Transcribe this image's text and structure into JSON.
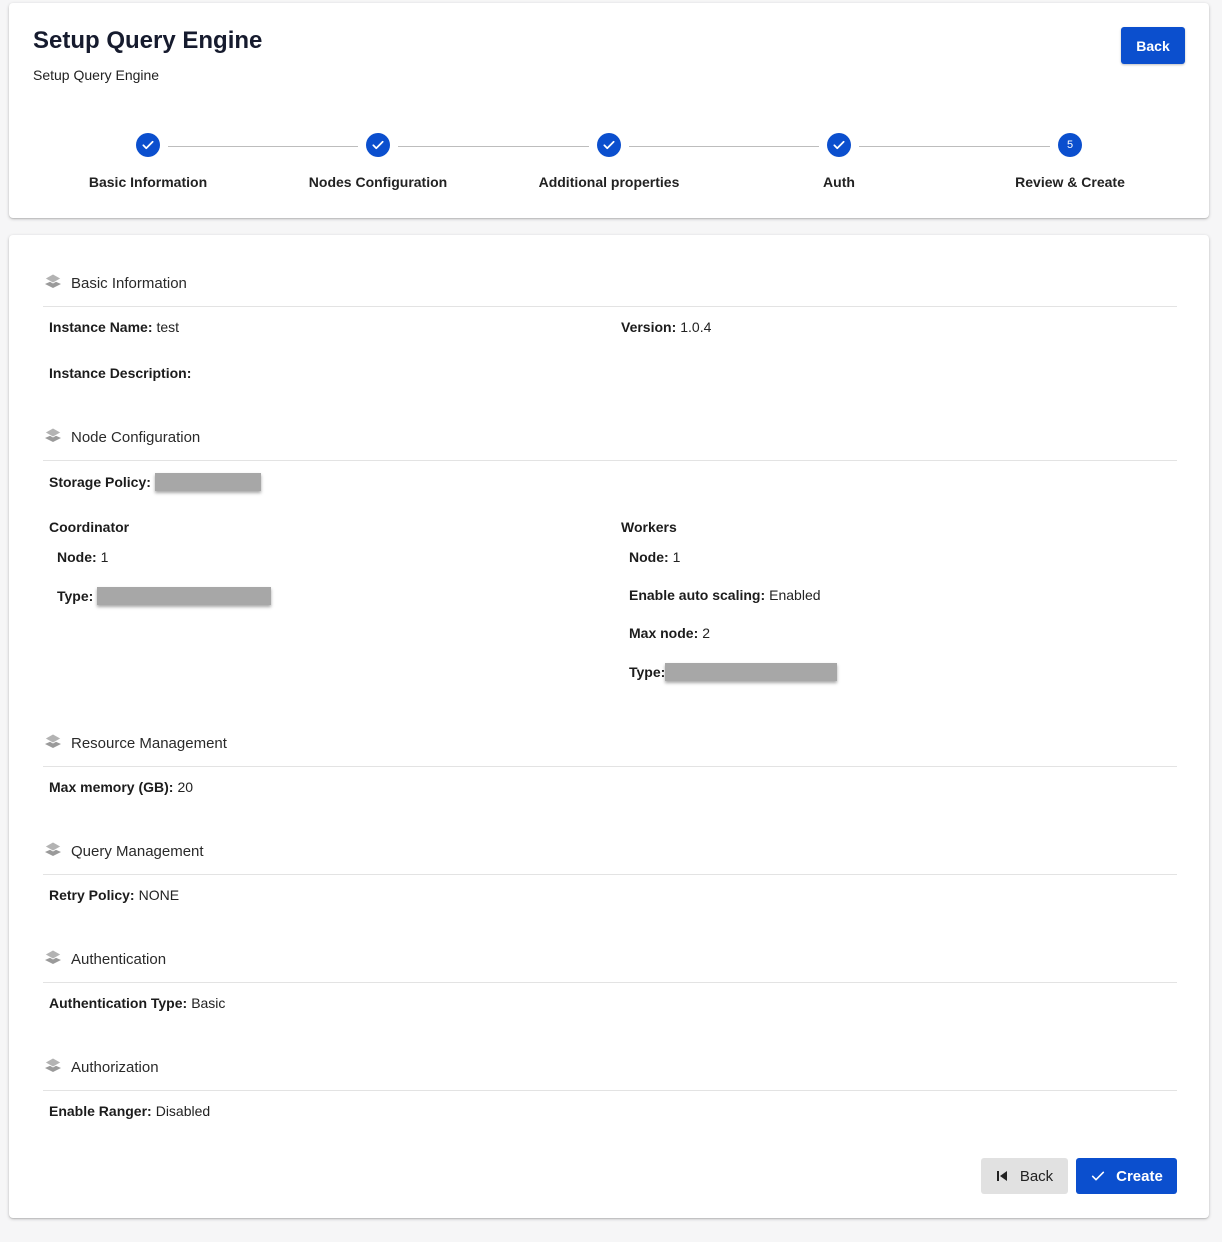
{
  "header": {
    "title": "Setup Query Engine",
    "subtitle": "Setup Query Engine",
    "back_label": "Back"
  },
  "stepper": {
    "steps": [
      {
        "label": "Basic Information",
        "state": "complete"
      },
      {
        "label": "Nodes Configuration",
        "state": "complete"
      },
      {
        "label": "Additional properties",
        "state": "complete"
      },
      {
        "label": "Auth",
        "state": "complete"
      },
      {
        "label": "Review & Create",
        "state": "active",
        "number": "5"
      }
    ]
  },
  "review": {
    "basic": {
      "title": "Basic Information",
      "instance_name_label": "Instance Name:",
      "instance_name": "test",
      "version_label": "Version:",
      "version": "1.0.4",
      "description_label": "Instance Description:",
      "description": ""
    },
    "nodes": {
      "title": "Node Configuration",
      "storage_policy_label": "Storage Policy:",
      "coordinator": {
        "heading": "Coordinator",
        "node_label": "Node:",
        "node": "1",
        "type_label": "Type:"
      },
      "workers": {
        "heading": "Workers",
        "node_label": "Node:",
        "node": "1",
        "autoscale_label": "Enable auto scaling:",
        "autoscale": "Enabled",
        "max_node_label": "Max node:",
        "max_node": "2",
        "type_label": "Type:"
      }
    },
    "resource": {
      "title": "Resource Management",
      "max_memory_label": "Max memory (GB):",
      "max_memory": "20"
    },
    "query": {
      "title": "Query Management",
      "retry_label": "Retry Policy:",
      "retry": "NONE"
    },
    "authentication": {
      "title": "Authentication",
      "type_label": "Authentication Type:",
      "type": "Basic"
    },
    "authorization": {
      "title": "Authorization",
      "ranger_label": "Enable Ranger:",
      "ranger": "Disabled"
    }
  },
  "actions": {
    "back_label": "Back",
    "create_label": "Create"
  },
  "colors": {
    "primary": "#0b4fce",
    "secondary_button": "#e1e1e1",
    "redaction": "#a7a7a7"
  },
  "icons": {
    "step_complete": "check-icon",
    "section": "layers-icon",
    "back": "skip-previous-icon",
    "create": "check-icon"
  }
}
